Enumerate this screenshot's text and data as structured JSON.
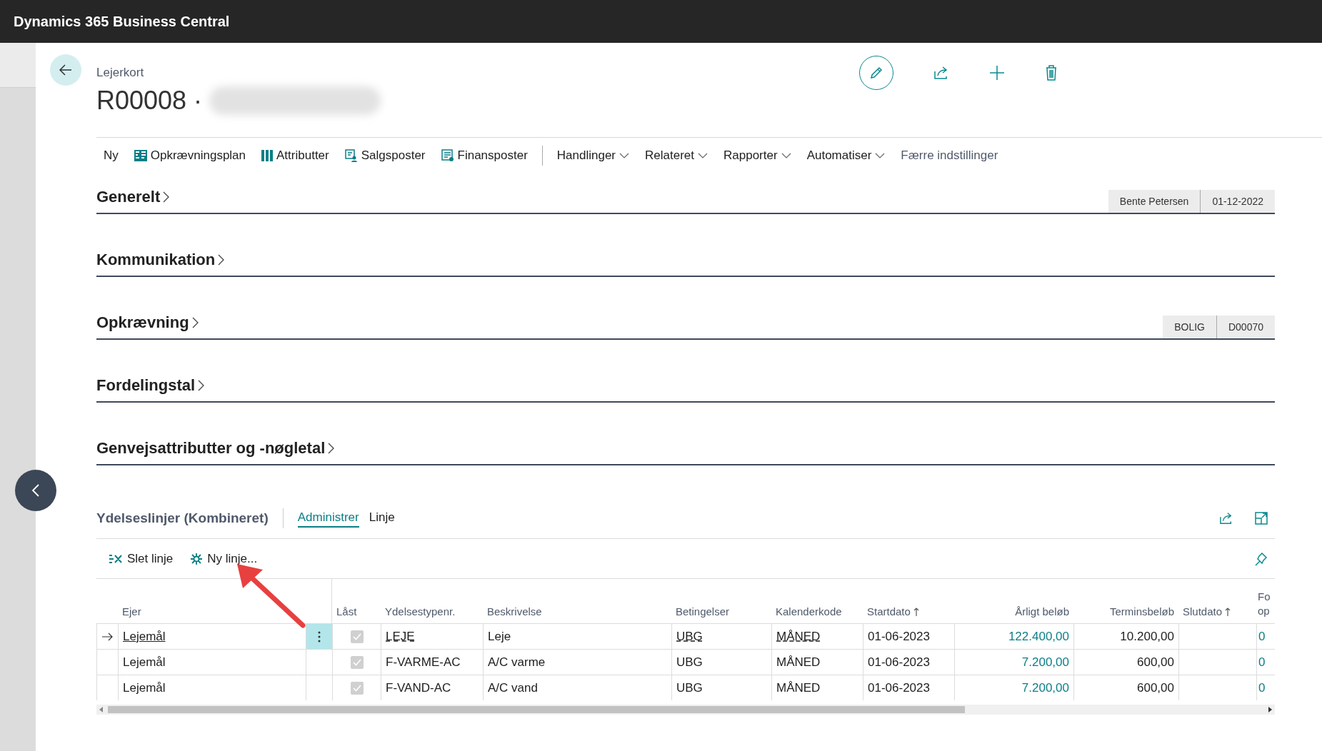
{
  "app_title": "Dynamics 365 Business Central",
  "page": {
    "breadcrumb": "Lejerkort",
    "title": "R00008 ·"
  },
  "actions": [
    {
      "label": "Ny",
      "kind": "plain"
    },
    {
      "label": "Opkrævningsplan",
      "kind": "plan"
    },
    {
      "label": "Attributter",
      "kind": "columns"
    },
    {
      "label": "Salgsposter",
      "kind": "sales"
    },
    {
      "label": "Finansposter",
      "kind": "ledger"
    },
    {
      "label": "Handlinger",
      "kind": "menu"
    },
    {
      "label": "Relateret",
      "kind": "menu"
    },
    {
      "label": "Rapporter",
      "kind": "menu"
    },
    {
      "label": "Automatiser",
      "kind": "menu"
    },
    {
      "label": "Færre indstillinger",
      "kind": "link"
    }
  ],
  "sections": [
    {
      "title": "Generelt",
      "fields": [
        "Bente Petersen",
        "01-12-2022"
      ]
    },
    {
      "title": "Kommunikation"
    },
    {
      "title": "Opkrævning",
      "fields": [
        "BOLIG",
        "D00070"
      ]
    },
    {
      "title": "Fordelingstal"
    },
    {
      "title": "Genvejsattributter og -nøgletal"
    }
  ],
  "part": {
    "title": "Ydelseslinjer (Kombineret)",
    "tabs": [
      {
        "label": "Administrer",
        "selected": true
      },
      {
        "label": "Linje",
        "selected": false
      }
    ],
    "actions": [
      {
        "label": "Slet linje",
        "kind": "delete"
      },
      {
        "label": "Ny linje...",
        "kind": "new"
      }
    ]
  },
  "table": {
    "columns": [
      {
        "label": "Ejer",
        "sorted": false
      },
      {
        "label": "Låst",
        "sorted": false
      },
      {
        "label": "Ydelsestypenr.",
        "sorted": false
      },
      {
        "label": "Beskrivelse",
        "sorted": false
      },
      {
        "label": "Betingelser",
        "sorted": false
      },
      {
        "label": "Kalenderkode",
        "sorted": false
      },
      {
        "label": "Startdato",
        "sorted": true
      },
      {
        "label": "Årligt beløb",
        "sorted": false
      },
      {
        "label": "Terminsbeløb",
        "sorted": false
      },
      {
        "label": "Slutdato",
        "sorted": true
      },
      {
        "label": "Fo op",
        "sorted": false
      }
    ],
    "rows": [
      {
        "selected": true,
        "owner": "Lejemål",
        "locked": true,
        "type_no": "LEJE",
        "description": "Leje",
        "terms": "UBG",
        "calendar_code": "MÅNED",
        "start_date": "01-06-2023",
        "annual_amount": "122.400,00",
        "term_amount": "10.200,00",
        "column_12": "0"
      },
      {
        "selected": false,
        "owner": "Lejemål",
        "locked": true,
        "type_no": "F-VARME-AC",
        "description": "A/C varme",
        "terms": "UBG",
        "calendar_code": "MÅNED",
        "start_date": "01-06-2023",
        "annual_amount": "7.200,00",
        "term_amount": "600,00",
        "column_12": "0"
      },
      {
        "selected": false,
        "owner": "Lejemål",
        "locked": true,
        "type_no": "F-VAND-AC",
        "description": "A/C vand",
        "terms": "UBG",
        "calendar_code": "MÅNED",
        "start_date": "01-06-2023",
        "annual_amount": "7.200,00",
        "term_amount": "600,00",
        "column_12": "0"
      }
    ]
  }
}
